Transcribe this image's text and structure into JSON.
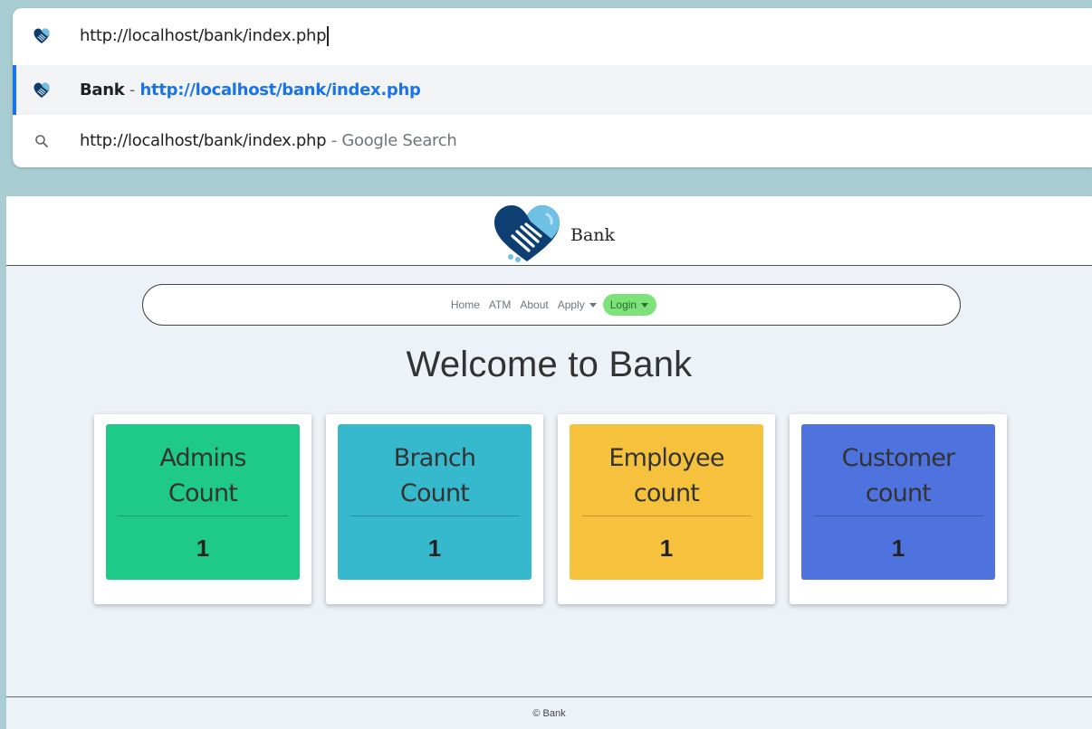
{
  "omnibox": {
    "input_value": "http://localhost/bank/index.php",
    "suggestion": {
      "title": "Bank",
      "separator": " - ",
      "url": "http://localhost/bank/index.php"
    },
    "search": {
      "query": "http://localhost/bank/index.php",
      "suffix": " - Google Search"
    }
  },
  "header": {
    "brand": "Bank"
  },
  "nav": {
    "home": "Home",
    "atm": "ATM",
    "about": "About",
    "apply": "Apply",
    "login": "Login"
  },
  "main": {
    "heading": "Welcome to Bank",
    "cards": [
      {
        "title": "Admins\nCount",
        "value": "1",
        "color": "#1fc987"
      },
      {
        "title": "Branch\nCount",
        "value": "1",
        "color": "#36b9cc"
      },
      {
        "title": "Employee\ncount",
        "value": "1",
        "color": "#f6c23e"
      },
      {
        "title": "Customer\ncount",
        "value": "1",
        "color": "#4e73df"
      }
    ]
  },
  "footer": {
    "text": "© Bank"
  },
  "colors": {
    "omnibox_accent": "#1a73e8",
    "login_button": "#7ee27b",
    "page_background": "#edf1f8"
  }
}
